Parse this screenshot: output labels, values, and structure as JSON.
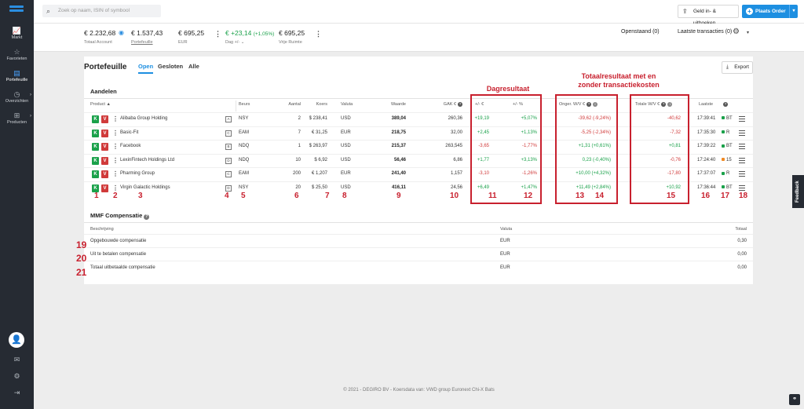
{
  "sidebar": {
    "items": [
      {
        "icon": "chart-icon",
        "glyph": "📈",
        "label": "Markt"
      },
      {
        "icon": "star-icon",
        "glyph": "☆",
        "label": "Favorieten"
      },
      {
        "icon": "portfolio-icon",
        "glyph": "▤",
        "label": "Portefeuille"
      },
      {
        "icon": "clock-icon",
        "glyph": "◷",
        "label": "Overzichten"
      },
      {
        "icon": "products-icon",
        "glyph": "⊞",
        "label": "Producten"
      }
    ],
    "avatar_glyph": "👤",
    "mail_glyph": "✉",
    "settings_glyph": "⚙",
    "logout_glyph": "⇥"
  },
  "topbar": {
    "search_placeholder": "Zoek op naam, ISIN of symbool",
    "cash_button": "Geld in- & uitboeken",
    "order_button": "Plaats Order"
  },
  "summary": {
    "total_account": {
      "value": "€ 2.232,68",
      "label": "Totaal Account"
    },
    "portfolio": {
      "value": "€ 1.537,43",
      "label": "Portefeuille"
    },
    "eur": {
      "value": "€ 695,25",
      "label": "EUR"
    },
    "day": {
      "value": "€ +23,14",
      "pct": "(+1,05%)",
      "label": "Dag +/- ⌄"
    },
    "free_space": {
      "value": "€ 695,25",
      "label": "Vrije Ruimte"
    },
    "open_orders": "Openstaand (0)",
    "last_transactions": "Laatste transacties (0)"
  },
  "portfolio": {
    "title": "Portefeuille",
    "tabs": [
      "Open",
      "Gesloten",
      "Alle"
    ],
    "export": "Export",
    "stocks_title": "Aandelen",
    "headers": {
      "product": "Product ▲",
      "exchange": "Beurs",
      "qty": "Aantal",
      "price": "Koers",
      "currency": "Valuta",
      "value": "Waarde",
      "gak": "GAK €",
      "day_eur": "+/- €",
      "day_pct": "+/- %",
      "unreal": "Onger. W/V €",
      "total": "Totale W/V €",
      "last": "Laatste"
    },
    "rows": [
      {
        "name": "Alibaba Group Holding",
        "type": "A",
        "exchange": "NSY",
        "qty": "2",
        "price": "$ 238,41",
        "currency": "USD",
        "value": "389,04",
        "gak": "260,36",
        "day_eur": "+19,19",
        "day_pct": "+5,07%",
        "unreal": "-39,62 (-9,24%)",
        "total": "-40,62",
        "time": "17:39:41",
        "status": "BT",
        "status_color": "#1aa14a",
        "day_color": "g",
        "unreal_color": "red",
        "total_color": "red",
        "hl": false
      },
      {
        "name": "Basic-Fit",
        "type": "C",
        "exchange": "EAM",
        "qty": "7",
        "price": "€ 31,25",
        "currency": "EUR",
        "value": "218,75",
        "gak": "32,00",
        "day_eur": "+2,45",
        "day_pct": "+1,13%",
        "unreal": "-5,25 (-2,34%)",
        "total": "-7,32",
        "time": "17:35:30",
        "status": "R",
        "status_color": "#1aa14a",
        "day_color": "g",
        "unreal_color": "red",
        "total_color": "red",
        "hl": false
      },
      {
        "name": "Facebook",
        "type": "B",
        "exchange": "NDQ",
        "qty": "1",
        "price": "$ 263,97",
        "currency": "USD",
        "value": "215,37",
        "gak": "263,545",
        "day_eur": "-3,65",
        "day_pct": "-1,77%",
        "unreal": "+1,31 (+0,61%)",
        "total": "+0,81",
        "time": "17:39:22",
        "status": "BT",
        "status_color": "#1aa14a",
        "day_color": "red",
        "unreal_color": "g",
        "total_color": "g",
        "hl": false
      },
      {
        "name": "LexinFintech Holdings Ltd",
        "type": "D",
        "exchange": "NDQ",
        "qty": "10",
        "price": "$ 6,92",
        "currency": "USD",
        "value": "56,46",
        "gak": "6,86",
        "day_eur": "+1,77",
        "day_pct": "+3,13%",
        "unreal": "0,23 (-0,40%)",
        "total": "-0,76",
        "time": "17:24:40",
        "status": "15",
        "status_color": "#f08a24",
        "day_color": "g",
        "unreal_color": "g",
        "total_color": "red",
        "hl": true
      },
      {
        "name": "Pharming Group",
        "type": "C",
        "exchange": "EAM",
        "qty": "200",
        "price": "€ 1,207",
        "currency": "EUR",
        "value": "241,40",
        "gak": "1,157",
        "day_eur": "-3,10",
        "day_pct": "-1,26%",
        "unreal": "+10,00 (+4,32%)",
        "total": "-17,80",
        "time": "17:37:07",
        "status": "R",
        "status_color": "#1aa14a",
        "day_color": "red",
        "unreal_color": "g",
        "total_color": "red",
        "hl": false
      },
      {
        "name": "Virgin Galactic Holdings",
        "type": "D",
        "exchange": "NSY",
        "qty": "20",
        "price": "$ 25,50",
        "currency": "USD",
        "value": "416,11",
        "gak": "24,56",
        "day_eur": "+6,49",
        "day_pct": "+1,47%",
        "unreal": "+11,49 (+2,84%)",
        "total": "+10,92",
        "time": "17:36:44",
        "status": "BT",
        "status_color": "#1aa14a",
        "day_color": "g",
        "unreal_color": "g",
        "total_color": "g",
        "hl": false
      }
    ]
  },
  "annotations": {
    "day_result": "Dagresultaat",
    "total_result": "Totaalresultaat met en zonder transactiekosten",
    "numbers": [
      "1",
      "2",
      "3",
      "4",
      "5",
      "6",
      "7",
      "8",
      "9",
      "10",
      "11",
      "12",
      "13",
      "14",
      "15",
      "16",
      "17",
      "18",
      "19",
      "20",
      "21"
    ]
  },
  "mmf": {
    "title": "MMF Compensatie",
    "headers": {
      "desc": "Beschrijving",
      "currency": "Valuta",
      "total": "Totaal"
    },
    "rows": [
      {
        "desc": "Opgebouwde compensatie",
        "currency": "EUR",
        "total": "0,30"
      },
      {
        "desc": "Uit te betalen compensatie",
        "currency": "EUR",
        "total": "0,00"
      },
      {
        "desc": "Totaal uitbetaalde compensatie",
        "currency": "EUR",
        "total": "0,00"
      }
    ]
  },
  "footer": "© 2021 - DEGIRO BV - Koersdata van: VWD group Euronext Chi-X Bats",
  "feedback": "Feedback",
  "colors": {
    "accent": "#1d8fe1",
    "green": "#1aa14a",
    "red": "#d03a3a",
    "annotation": "#c8202e",
    "sidebar": "#262b33"
  }
}
